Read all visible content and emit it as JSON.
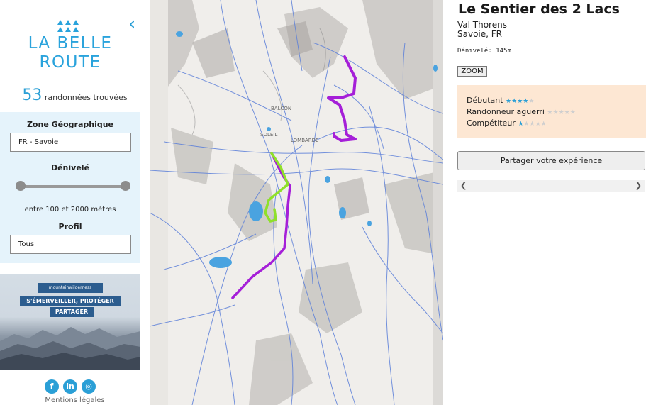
{
  "sidebar": {
    "logo": {
      "line1": "LA BELLE",
      "line2": "ROUTE"
    },
    "results_count": "53",
    "results_label": "randonnées trouvées",
    "filters": {
      "zone_label": "Zone Géographique",
      "zone_value": "FR - Savoie",
      "elevation_label": "Dénivelé",
      "elevation_range_text": "entre 100 et 2000 mètres",
      "profile_label": "Profil",
      "profile_value": "Tous"
    },
    "banner": {
      "brand": "mountainwilderness",
      "line1": "S'ÉMERVEILLER, PROTÉGER",
      "line2": "PARTAGER"
    },
    "legal_link": "Mentions légales"
  },
  "map": {
    "labels": [
      "BALCON",
      "SOLEIL",
      "LOMBARDE"
    ],
    "route_colors": {
      "main": "#a51fd8",
      "variant": "#8fe02a",
      "water": "#4aa3e0",
      "trails": "#5b7fd9"
    }
  },
  "trail": {
    "title": "Le Sentier des 2 Lacs",
    "location_line1": "Val Thorens",
    "location_line2": "Savoie, FR",
    "elevation": "Dénivelé: 145m",
    "zoom_label": "ZOOM",
    "levels": [
      {
        "label": "Débutant",
        "stars": 4,
        "max": 5
      },
      {
        "label": "Randonneur aguerri",
        "stars": 0,
        "max": 5
      },
      {
        "label": "Compétiteur",
        "stars": 1,
        "max": 5
      }
    ],
    "share_label": "Partager votre expérience"
  }
}
